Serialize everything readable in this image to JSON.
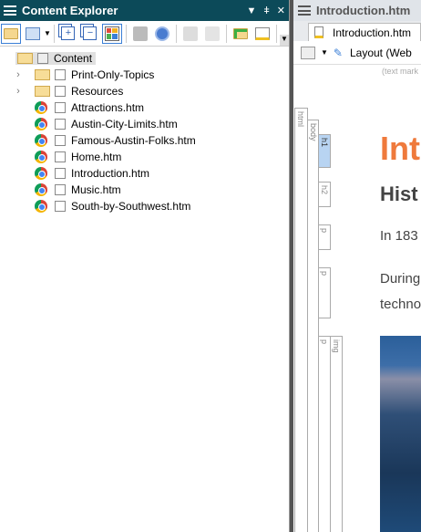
{
  "explorer": {
    "title": "Content Explorer",
    "controls": {
      "menu": "▾",
      "pin": "📌",
      "close": "✕"
    },
    "toolbar": [
      "open-folder",
      "view-grid",
      "dropdown",
      "expand-all",
      "collapse-all",
      "color-view",
      "move-up",
      "sync",
      "check-in",
      "preview",
      "new-folder",
      "new-topic"
    ],
    "tree": {
      "root": "Content",
      "items": [
        {
          "label": "Print-Only-Topics",
          "type": "folder",
          "expandable": true
        },
        {
          "label": "Resources",
          "type": "folder",
          "expandable": true
        },
        {
          "label": "Attractions.htm",
          "type": "file"
        },
        {
          "label": "Austin-City-Limits.htm",
          "type": "file"
        },
        {
          "label": "Famous-Austin-Folks.htm",
          "type": "file"
        },
        {
          "label": "Home.htm",
          "type": "file"
        },
        {
          "label": "Introduction.htm",
          "type": "file"
        },
        {
          "label": "Music.htm",
          "type": "file"
        },
        {
          "label": "South-by-Southwest.htm",
          "type": "file"
        }
      ]
    }
  },
  "editor": {
    "title": "Introduction.htm",
    "tab": "Introduction.htm",
    "layout_label": "Layout (Web",
    "text_mark": "(text mark",
    "structure": [
      "html",
      "body",
      "h1",
      "h2",
      "p",
      "p",
      "p",
      "img"
    ],
    "content": {
      "h1": "Intr",
      "h2": "Hist",
      "p1": "In 183",
      "p2a": "During",
      "p2b": "techno"
    }
  }
}
